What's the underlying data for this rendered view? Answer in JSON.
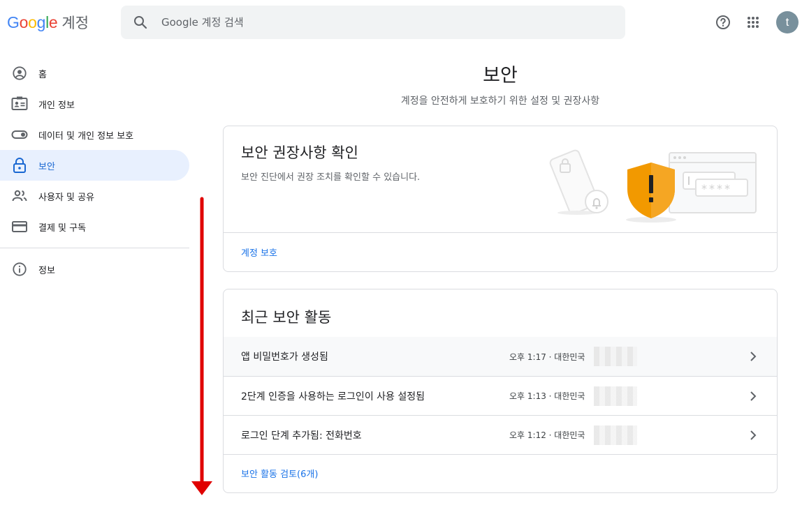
{
  "header": {
    "logo_letters": [
      "G",
      "o",
      "o",
      "g",
      "l",
      "e"
    ],
    "logo_colors": [
      "#4285F4",
      "#EA4335",
      "#FBBC05",
      "#4285F4",
      "#34A853",
      "#EA4335"
    ],
    "product": "계정",
    "search_placeholder": "Google 계정 검색",
    "avatar_letter": "t",
    "icons": [
      "search-icon",
      "help-icon",
      "apps-icon"
    ]
  },
  "sidebar": {
    "items": [
      {
        "label": "홈",
        "icon": "account-circle-icon"
      },
      {
        "label": "개인 정보",
        "icon": "id-card-icon"
      },
      {
        "label": "데이터 및 개인 정보 보호",
        "icon": "toggle-icon"
      },
      {
        "label": "보안",
        "icon": "lock-icon"
      },
      {
        "label": "사용자 및 공유",
        "icon": "people-icon"
      },
      {
        "label": "결제 및 구독",
        "icon": "credit-card-icon"
      }
    ],
    "footer_items": [
      {
        "label": "정보",
        "icon": "info-icon"
      }
    ]
  },
  "main": {
    "title": "보안",
    "subtitle": "계정을 안전하게 보호하기 위한 설정 및 권장사항",
    "recommendations_card": {
      "title": "보안 권장사항 확인",
      "description": "보안 진단에서 권장 조치를 확인할 수 있습니다.",
      "link": "계정 보호",
      "password_mask": "****"
    },
    "activity_card": {
      "title": "최근 보안 활동",
      "rows": [
        {
          "text": "앱 비밀번호가 생성됨",
          "meta": "오후 1:17 · 대한민국"
        },
        {
          "text": "2단계 인증을 사용하는 로그인이 사용 설정됨",
          "meta": "오후 1:13 · 대한민국"
        },
        {
          "text": "로그인 단계 추가됨: 전화번호",
          "meta": "오후 1:12 · 대한민국"
        }
      ],
      "link": "보안 활동 검토(6개)"
    }
  },
  "colors": {
    "accent": "#1a73e8",
    "active_bg": "#e8f0fe",
    "shield": "#f29900",
    "arrow": "#e00000"
  }
}
